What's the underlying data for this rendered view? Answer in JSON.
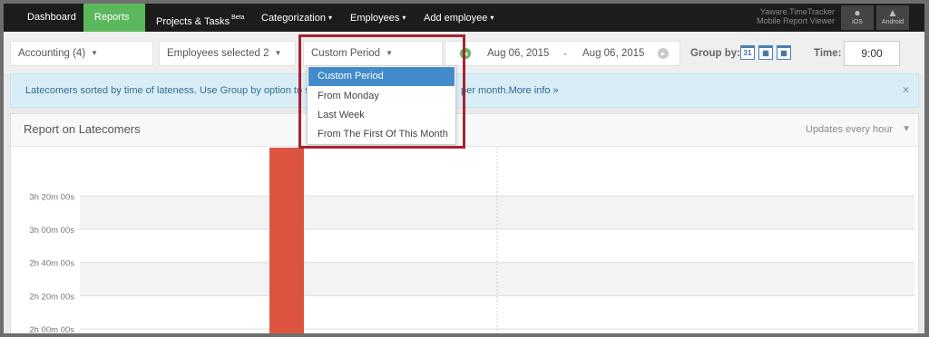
{
  "nav": {
    "items": [
      {
        "label": "Dashboard",
        "caret": false
      },
      {
        "label": "Reports",
        "caret": true,
        "active": true
      },
      {
        "label": "Projects & Tasks",
        "sup": "Beta",
        "caret": false
      },
      {
        "label": "Categorization",
        "caret": true
      },
      {
        "label": "Employees",
        "caret": true
      },
      {
        "label": "Add employee",
        "caret": true
      }
    ],
    "viewer_line1": "Yaware.TimeTracker",
    "viewer_line2": "Mobile Report Viewer",
    "ios_label": "iOS",
    "android_label": "Android"
  },
  "filters": {
    "department": "Accounting (4)",
    "employees": "Employees selected 2",
    "period": "Custom Period",
    "date_from": "Aug 06, 2015",
    "date_separator": "-",
    "date_to": "Aug 06, 2015",
    "group_by_label": "Group by:",
    "group_by_day": "31",
    "time_label": "Time:",
    "time_value": "9:00"
  },
  "period_dropdown": {
    "options": [
      "Custom Period",
      "From Monday",
      "Last Week",
      "From The First Of This Month"
    ],
    "selected": "Custom Period"
  },
  "info": {
    "text": "Latecomers sorted by time of lateness. Use Group by option to see p",
    "tail": "per month.",
    "link": "More info »",
    "close": "×"
  },
  "report": {
    "title": "Report on Latecomers",
    "updates": "Updates every hour"
  },
  "chart_data": {
    "type": "bar",
    "y_ticks": [
      "3h 20m 00s",
      "3h 00m 00s",
      "2h 40m 00s",
      "2h 20m 00s",
      "2h 00m 00s"
    ],
    "y_tick_values_minutes": [
      200,
      180,
      160,
      140,
      120
    ],
    "ylim_minutes_visible": [
      113,
      229
    ],
    "bars": [
      {
        "value_minutes": 229,
        "color": "#dd5540"
      }
    ],
    "grid": true
  },
  "colors": {
    "nav_bg": "#1c1c1c",
    "nav_active": "#5cb85c",
    "info_bg": "#d9edf7",
    "dropdown_selected": "#428bca",
    "bar": "#dd5540",
    "highlight_border": "#a8232e"
  }
}
